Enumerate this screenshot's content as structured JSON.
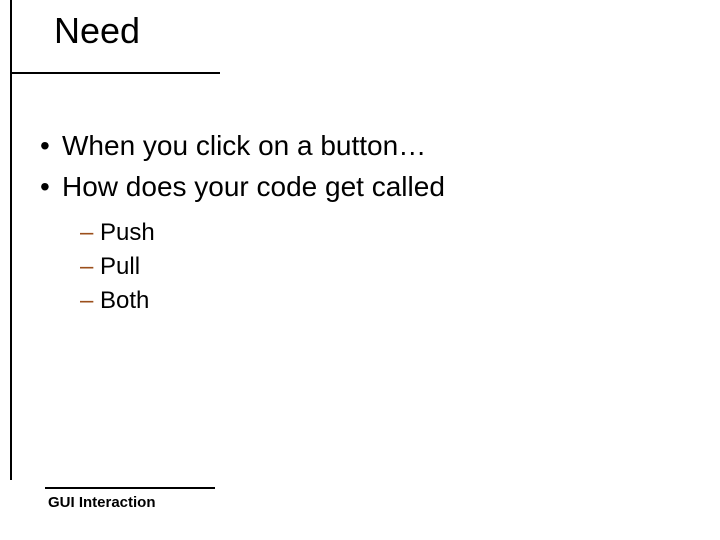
{
  "title": "Need",
  "bullets": {
    "items": [
      "When you click on a button…",
      "How does your code get called"
    ],
    "sub": [
      "Push",
      "Pull",
      "Both"
    ]
  },
  "footer": "GUI Interaction"
}
